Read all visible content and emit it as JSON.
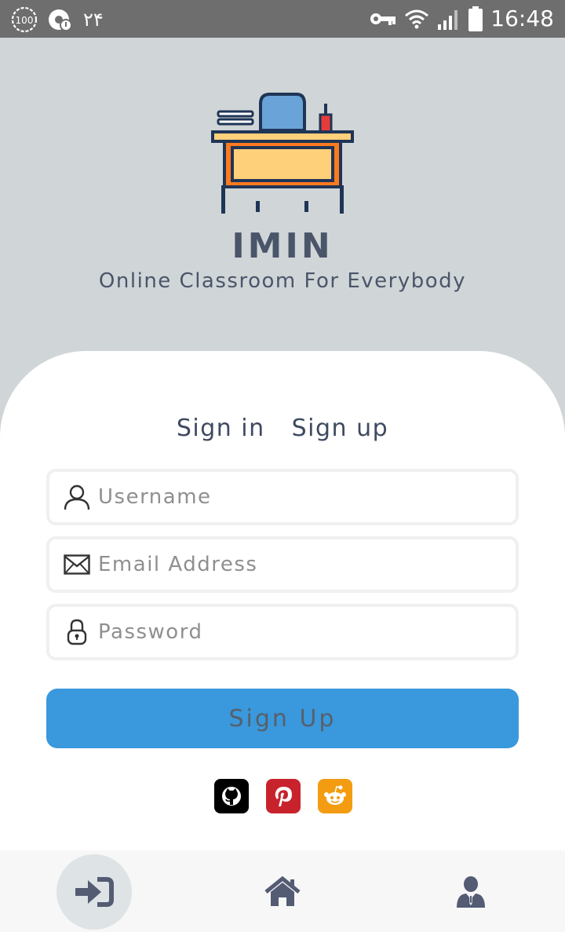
{
  "status_bar": {
    "battery_saver_level": "100",
    "notification_text": "۲۴",
    "time": "16:48"
  },
  "app": {
    "name": "IMIN",
    "tagline": "Online Classroom For Everybody"
  },
  "auth_tabs": {
    "sign_in": "Sign in",
    "sign_up": "Sign up"
  },
  "form": {
    "username": {
      "value": "",
      "placeholder": "Username",
      "icon": "user-icon"
    },
    "email": {
      "value": "",
      "placeholder": "Email Address",
      "icon": "envelope-icon"
    },
    "password": {
      "value": "",
      "placeholder": "Password",
      "icon": "lock-icon"
    },
    "submit_label": "Sign Up"
  },
  "social": [
    {
      "name": "github-icon",
      "color": "#000000"
    },
    {
      "name": "pinterest-icon",
      "color": "#c8232c"
    },
    {
      "name": "reddit-icon",
      "color": "#f39c12"
    }
  ],
  "bottom_nav": [
    {
      "name": "login-icon",
      "active": true
    },
    {
      "name": "home-icon",
      "active": false
    },
    {
      "name": "profile-icon",
      "active": false
    }
  ],
  "colors": {
    "hero_background": "#d0d5d7",
    "primary": "#3a98dc",
    "text_dark": "#4a556a",
    "nav_icon": "#545c74"
  }
}
